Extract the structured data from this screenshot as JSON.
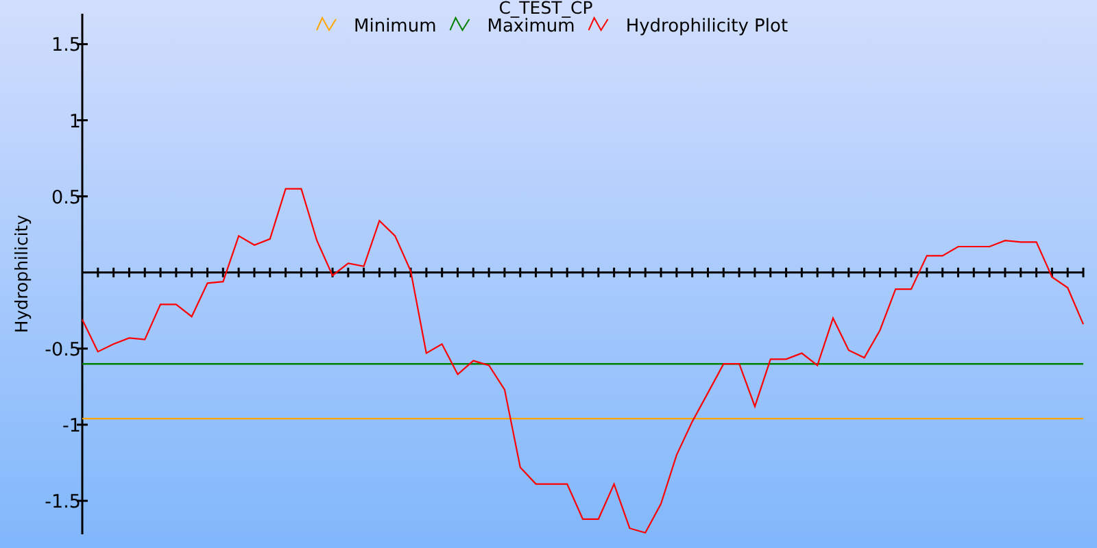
{
  "chart": {
    "chart_data": {
      "type": "line",
      "title": "C_TEST_CP",
      "legend": "top",
      "ylabel": "Hydrophilicity",
      "ylim": [
        -1.72,
        1.7
      ],
      "yticks": [
        -1.5,
        -1,
        -0.5,
        0.5,
        1,
        1.5
      ],
      "series": [
        {
          "name": "Minimum",
          "color": "#ffa500",
          "values": [
            -0.96,
            -0.96,
            -0.96,
            -0.96,
            -0.96,
            -0.96,
            -0.96,
            -0.96,
            -0.96,
            -0.96,
            -0.96,
            -0.96,
            -0.96,
            -0.96,
            -0.96,
            -0.96,
            -0.96,
            -0.96,
            -0.96,
            -0.96,
            -0.96,
            -0.96,
            -0.96,
            -0.96,
            -0.96,
            -0.96,
            -0.96,
            -0.96,
            -0.96,
            -0.96,
            -0.96,
            -0.96,
            -0.96,
            -0.96,
            -0.96,
            -0.96,
            -0.96,
            -0.96,
            -0.96,
            -0.96,
            -0.96,
            -0.96,
            -0.96,
            -0.96,
            -0.96,
            -0.96,
            -0.96,
            -0.96,
            -0.96,
            -0.96,
            -0.96,
            -0.96,
            -0.96,
            -0.96,
            -0.96,
            -0.96,
            -0.96,
            -0.96,
            -0.96,
            -0.96,
            -0.96,
            -0.96,
            -0.96,
            -0.96,
            -0.96
          ]
        },
        {
          "name": "Maximum",
          "color": "#008000",
          "values": [
            -0.6,
            -0.6,
            -0.6,
            -0.6,
            -0.6,
            -0.6,
            -0.6,
            -0.6,
            -0.6,
            -0.6,
            -0.6,
            -0.6,
            -0.6,
            -0.6,
            -0.6,
            -0.6,
            -0.6,
            -0.6,
            -0.6,
            -0.6,
            -0.6,
            -0.6,
            -0.6,
            -0.6,
            -0.6,
            -0.6,
            -0.6,
            -0.6,
            -0.6,
            -0.6,
            -0.6,
            -0.6,
            -0.6,
            -0.6,
            -0.6,
            -0.6,
            -0.6,
            -0.6,
            -0.6,
            -0.6,
            -0.6,
            -0.6,
            -0.6,
            -0.6,
            -0.6,
            -0.6,
            -0.6,
            -0.6,
            -0.6,
            -0.6,
            -0.6,
            -0.6,
            -0.6,
            -0.6,
            -0.6,
            -0.6,
            -0.6,
            -0.6,
            -0.6,
            -0.6,
            -0.6,
            -0.6,
            -0.6,
            -0.6,
            -0.6
          ]
        },
        {
          "name": "Hydrophilicity Plot",
          "color": "#ff0000",
          "values": [
            -0.31,
            -0.52,
            -0.47,
            -0.43,
            -0.44,
            -0.21,
            -0.21,
            -0.29,
            -0.07,
            -0.06,
            0.24,
            0.18,
            0.22,
            0.55,
            0.55,
            0.21,
            -0.02,
            0.06,
            0.04,
            0.34,
            0.24,
            0.01,
            -0.53,
            -0.47,
            -0.67,
            -0.58,
            -0.61,
            -0.77,
            -1.28,
            -1.39,
            -1.39,
            -1.39,
            -1.62,
            -1.62,
            -1.39,
            -1.68,
            -1.71,
            -1.52,
            -1.2,
            -0.98,
            -0.79,
            -0.6,
            -0.6,
            -0.88,
            -0.57,
            -0.57,
            -0.53,
            -0.61,
            -0.3,
            -0.51,
            -0.56,
            -0.38,
            -0.11,
            -0.11,
            0.11,
            0.11,
            0.17,
            0.17,
            0.17,
            0.21,
            0.2,
            0.2,
            -0.03,
            -0.1,
            -0.34
          ]
        }
      ]
    }
  }
}
